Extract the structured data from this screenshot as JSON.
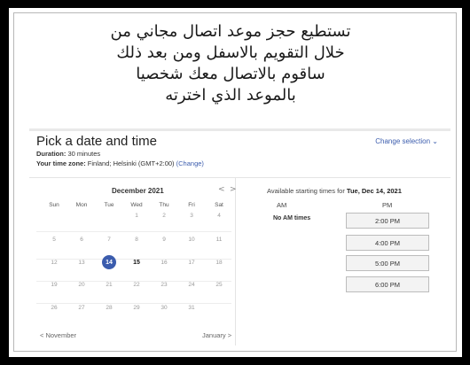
{
  "intro_text": {
    "line1": "تستطيع حجز موعد اتصال مجاني من",
    "line2": "خلال التقويم بالاسفل ومن بعد ذلك",
    "line3": "ساقوم بالاتصال معك شخصيا",
    "line4": "بالموعد الذي اخترته"
  },
  "header": {
    "title": "Pick a date and time",
    "duration_label": "Duration:",
    "duration_value": "30 minutes",
    "timezone_label": "Your time zone:",
    "timezone_value": "Finland; Helsinki (GMT+2:00)",
    "timezone_change": "(Change)",
    "change_selection": "Change selection ⌄"
  },
  "calendar": {
    "month_label": "December 2021",
    "prev_arrow": "<",
    "next_arrow": ">",
    "weekdays": [
      "Sun",
      "Mon",
      "Tue",
      "Wed",
      "Thu",
      "Fri",
      "Sat"
    ],
    "weeks": [
      [
        "",
        "",
        "",
        "1",
        "2",
        "3",
        "4"
      ],
      [
        "5",
        "6",
        "7",
        "8",
        "9",
        "10",
        "11"
      ],
      [
        "12",
        "13",
        "14",
        "15",
        "16",
        "17",
        "18"
      ],
      [
        "19",
        "20",
        "21",
        "22",
        "23",
        "24",
        "25"
      ],
      [
        "26",
        "27",
        "28",
        "29",
        "30",
        "31",
        ""
      ]
    ],
    "selected_day": "14",
    "available_days": [
      "15"
    ],
    "prev_month": "< November",
    "next_month": "January >"
  },
  "times": {
    "available_prefix": "Available starting times for",
    "available_date": "Tue, Dec 14, 2021",
    "am_header": "AM",
    "pm_header": "PM",
    "no_am": "No AM times",
    "pm_slots": [
      "2:00 PM",
      "4:00 PM",
      "5:00 PM",
      "6:00 PM"
    ]
  },
  "colors": {
    "accent": "#3b5cad",
    "frame_background": "#000000"
  }
}
